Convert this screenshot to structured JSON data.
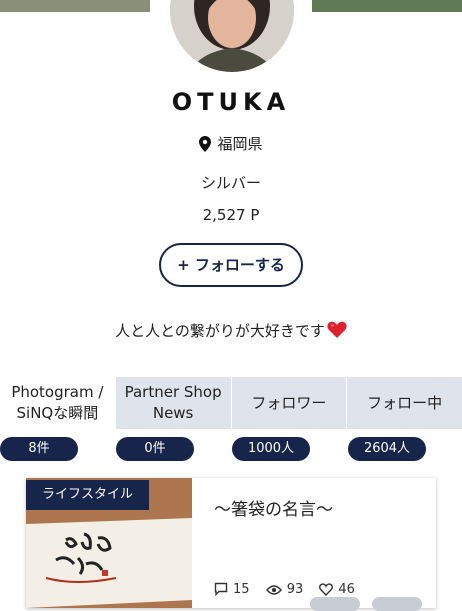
{
  "profile": {
    "username": "OTUKA",
    "location": "福岡県",
    "rank": "シルバー",
    "points": "2,527 P",
    "follow_label": "+ フォローする",
    "bio": "人と人との繋がりが大好きです"
  },
  "tabs": [
    {
      "label_line1": "Photogram /",
      "label_line2": "SiNQな瞬間",
      "count": "8件"
    },
    {
      "label_line1": "Partner Shop",
      "label_line2": "News",
      "count": "0件"
    },
    {
      "label_line1": "フォロワー",
      "label_line2": "",
      "count": "1000人"
    },
    {
      "label_line1": "フォロー中",
      "label_line2": "",
      "count": "2604人"
    }
  ],
  "post": {
    "category": "ライフスタイル",
    "title": "〜箸袋の名言〜",
    "comments": "15",
    "views": "93",
    "likes": "46"
  },
  "colors": {
    "navy": "#17254a",
    "tab_bg": "#dfe3ea",
    "heart": "#e0202c"
  },
  "icons": [
    "location-pin-icon",
    "heart-emoji-icon",
    "comment-icon",
    "eye-icon",
    "heart-icon"
  ]
}
